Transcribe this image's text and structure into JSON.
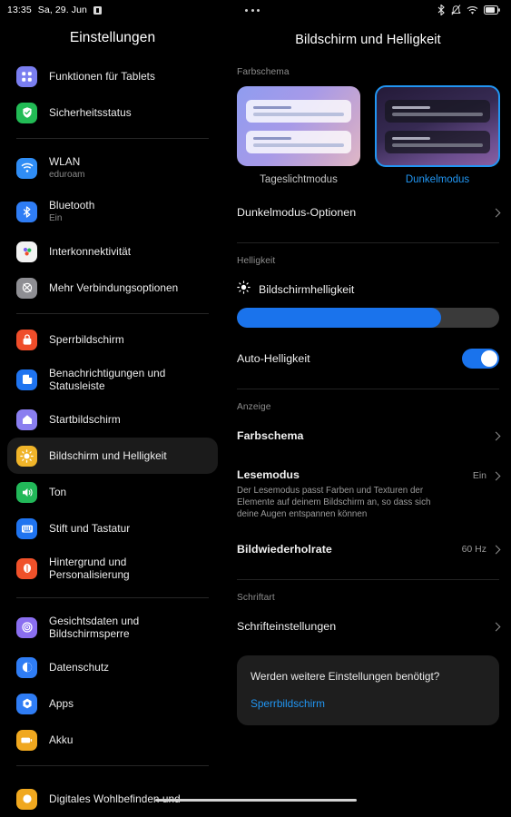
{
  "statusbar": {
    "time": "13:35",
    "date": "Sa, 29. Jun",
    "app_icon": "saved-app-icon",
    "icons": [
      "bluetooth-icon",
      "notifications-muted-icon",
      "wifi-icon",
      "battery-icon"
    ]
  },
  "sidebar": {
    "title": "Einstellungen",
    "groups": [
      {
        "items": [
          {
            "label": "Funktionen für Tablets",
            "icon": "tablet-features-icon",
            "color": "#7a7ef0"
          },
          {
            "label": "Sicherheitsstatus",
            "icon": "shield-check-icon",
            "color": "#22bb55"
          }
        ]
      },
      {
        "items": [
          {
            "label": "WLAN",
            "sub": "eduroam",
            "icon": "wifi-icon",
            "color": "#2f8df5"
          },
          {
            "label": "Bluetooth",
            "sub": "Ein",
            "icon": "bluetooth-icon",
            "color": "#2f7df5"
          },
          {
            "label": "Interkonnektivität",
            "icon": "interconnect-icon",
            "color": "#f2f2f2"
          },
          {
            "label": "Mehr Verbindungsoptionen",
            "icon": "more-connections-icon",
            "color": "#8e8e93"
          }
        ]
      },
      {
        "items": [
          {
            "label": "Sperrbildschirm",
            "icon": "lock-icon",
            "color": "#ef4d2a"
          },
          {
            "label": "Benachrichtigungen und Statusleiste",
            "icon": "notifications-icon",
            "color": "#1f74f0"
          },
          {
            "label": "Startbildschirm",
            "icon": "home-icon",
            "color": "#8a7ef0"
          },
          {
            "label": "Bildschirm und Helligkeit",
            "icon": "brightness-icon",
            "color": "#f0b429",
            "selected": true
          },
          {
            "label": "Ton",
            "icon": "sound-icon",
            "color": "#22b859"
          },
          {
            "label": "Stift und Tastatur",
            "icon": "keyboard-icon",
            "color": "#1f74f0"
          },
          {
            "label": "Hintergrund und Personalisierung",
            "icon": "wallpaper-icon",
            "color": "#f0512a"
          }
        ]
      },
      {
        "items": [
          {
            "label": "Gesichtsdaten und Bildschirmsperre",
            "icon": "face-unlock-icon",
            "color": "#8a6ef0"
          },
          {
            "label": "Datenschutz",
            "icon": "privacy-icon",
            "color": "#2f7df5"
          },
          {
            "label": "Apps",
            "icon": "apps-icon",
            "color": "#2f7df5"
          },
          {
            "label": "Akku",
            "icon": "battery-icon",
            "color": "#f0a81f"
          }
        ]
      },
      {
        "items": [
          {
            "label": "Digitales Wohlbefinden und",
            "icon": "wellbeing-icon",
            "color": "#f0a81f"
          }
        ]
      }
    ]
  },
  "content": {
    "overflow_menu": "more-options-icon",
    "title": "Bildschirm und Helligkeit",
    "colorscheme_section_label": "Farbschema",
    "themes": [
      {
        "caption": "Tageslichtmodus",
        "mode": "light",
        "selected": false
      },
      {
        "caption": "Dunkelmodus",
        "mode": "dark",
        "selected": true
      }
    ],
    "dark_mode_options": {
      "label": "Dunkelmodus-Optionen"
    },
    "brightness_section_label": "Helligkeit",
    "screen_brightness": {
      "label": "Bildschirmhelligkeit",
      "icon": "sun-icon",
      "value_percent": 78
    },
    "auto_brightness": {
      "label": "Auto-Helligkeit",
      "enabled": true
    },
    "display_section_label": "Anzeige",
    "display_rows": [
      {
        "label": "Farbschema",
        "value": ""
      },
      {
        "label": "Lesemodus",
        "desc": "Der Lesemodus passt Farben und Texturen der Elemente auf deinem Bildschirm an, so dass sich deine Augen entspannen können",
        "value": "Ein"
      },
      {
        "label": "Bildwiederholrate",
        "value": "60 Hz"
      }
    ],
    "font_section_label": "Schriftart",
    "font_row": {
      "label": "Schrifteinstellungen"
    },
    "suggestion": {
      "question": "Werden weitere Einstellungen benötigt?",
      "link": "Sperrbildschirm"
    }
  },
  "colors": {
    "accent": "#2196f3",
    "slider_fill": "#1a73ec",
    "background": "#000000",
    "selected_nav_bg": "#1b1b1b"
  }
}
